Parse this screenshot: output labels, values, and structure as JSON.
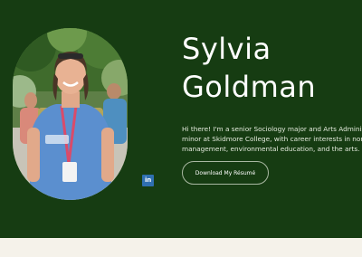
{
  "hero": {
    "name_line1": "Sylvia",
    "name_line2": "Goldman",
    "bio_line1": "Hi there! I'm a senior Sociology major and Arts Administration",
    "bio_line2": "minor at Skidmore College, with career interests in nonprofit",
    "bio_line3": "management, environmental education, and the arts.",
    "download_label": "Download My Résumé",
    "linkedin_glyph": "in",
    "portrait_alt": "Sylvia Goldman portrait"
  },
  "colors": {
    "hero_background": "#163c12",
    "page_background": "#f5f2ea",
    "linkedin_blue": "#2f6fb0",
    "text": "#ffffff"
  },
  "icons": {
    "linkedin": "linkedin-icon"
  }
}
